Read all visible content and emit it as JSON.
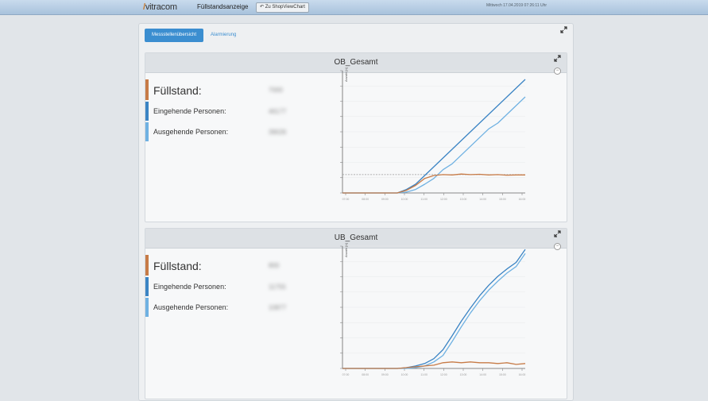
{
  "header": {
    "logo_text": "vitracom",
    "title": "Füllstandsanzeige",
    "back_button": "Zu ShopViewChart",
    "datetime": "Mittwoch 17.04.2019 07:26:11 Uhr"
  },
  "tabs": [
    {
      "label": "Messstellenübersicht",
      "active": true
    },
    {
      "label": "Alarmierung",
      "active": false
    }
  ],
  "colors": {
    "fill": "#c77b47",
    "incoming": "#3b84c4",
    "outgoing": "#6fb1e2",
    "tab_active": "#3b8ed0"
  },
  "cards": [
    {
      "title": "OB_Gesamt",
      "metrics": [
        {
          "label": "Füllstand:",
          "value": "7000"
        },
        {
          "label": "Eingehende Personen:",
          "value": "46177"
        },
        {
          "label": "Ausgehende Personen:",
          "value": "39026"
        }
      ],
      "y_axis_title": "Anzahl [n]",
      "y_ticks": [
        "",
        "",
        "",
        "",
        "",
        "",
        "",
        "",
        ""
      ],
      "x_ticks": [
        "07:00",
        "08:00",
        "09:00",
        "10:00",
        "11:00",
        "12:00",
        "13:00",
        "14:00",
        "15:00",
        "16:00"
      ]
    },
    {
      "title": "UB_Gesamt",
      "metrics": [
        {
          "label": "Füllstand:",
          "value": "800"
        },
        {
          "label": "Eingehende Personen:",
          "value": "11755"
        },
        {
          "label": "Ausgehende Personen:",
          "value": "10877"
        }
      ],
      "y_axis_title": "Anzahl [n]",
      "y_ticks": [
        "",
        "",
        "",
        "",
        "",
        "",
        "",
        "",
        ""
      ],
      "x_ticks": [
        "07:00",
        "08:00",
        "09:00",
        "10:00",
        "11:00",
        "12:00",
        "13:00",
        "14:00",
        "15:00",
        "16:00"
      ]
    }
  ],
  "chart_data": [
    {
      "type": "line",
      "x": [
        0,
        1,
        2,
        3,
        4,
        5,
        6,
        7,
        8,
        9,
        10,
        11,
        12,
        13,
        14,
        15,
        16,
        17,
        18,
        19,
        20
      ],
      "series": [
        {
          "name": "Eingehende Personen",
          "values": [
            0,
            0,
            0,
            0,
            0,
            0,
            0,
            1.2,
            3,
            6,
            9,
            12,
            15,
            18,
            21,
            24,
            27,
            30,
            33,
            36,
            39
          ]
        },
        {
          "name": "Ausgehende Personen",
          "values": [
            0,
            0,
            0,
            0,
            0,
            0,
            0,
            0.3,
            1.2,
            3,
            5,
            8,
            10,
            13,
            16,
            19,
            22,
            24,
            27,
            30,
            33
          ]
        },
        {
          "name": "Füllstand",
          "values": [
            0,
            0,
            0,
            0,
            0,
            0,
            0,
            0.9,
            2.6,
            5,
            6,
            6.3,
            6.2,
            6.5,
            6.3,
            6.4,
            6.2,
            6.3,
            6.1,
            6.2,
            6.2
          ]
        }
      ],
      "threshold": 6.3,
      "ylim": [
        0,
        42
      ]
    },
    {
      "type": "line",
      "x": [
        0,
        1,
        2,
        3,
        4,
        5,
        6,
        7,
        8,
        9,
        10,
        11,
        12,
        13,
        14,
        15,
        16,
        17,
        18,
        19,
        20
      ],
      "series": [
        {
          "name": "Eingehende Personen",
          "values": [
            0,
            0,
            0,
            0,
            0,
            0,
            0,
            0.1,
            0.3,
            0.6,
            1.2,
            2.3,
            4,
            5.8,
            7.4,
            8.9,
            10.2,
            11.3,
            12.2,
            13,
            14.6
          ]
        },
        {
          "name": "Ausgehende Personen",
          "values": [
            0,
            0,
            0,
            0,
            0,
            0,
            0,
            0,
            0.1,
            0.3,
            0.8,
            1.6,
            3.3,
            5.1,
            6.8,
            8.3,
            9.6,
            10.7,
            11.7,
            12.5,
            14.1
          ]
        },
        {
          "name": "Füllstand",
          "values": [
            0,
            0,
            0,
            0,
            0,
            0,
            0,
            0.1,
            0.2,
            0.3,
            0.4,
            0.7,
            0.8,
            0.7,
            0.8,
            0.7,
            0.7,
            0.6,
            0.7,
            0.5,
            0.6
          ]
        }
      ],
      "ylim": [
        0,
        15
      ]
    }
  ]
}
